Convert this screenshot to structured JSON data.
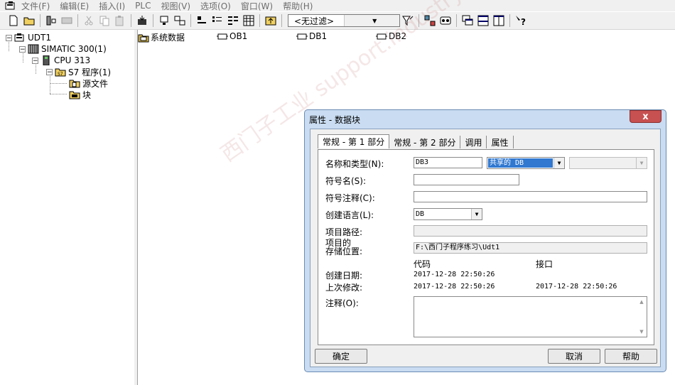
{
  "menubar": {
    "items": [
      "文件(F)",
      "编辑(E)",
      "插入(I)",
      "PLC",
      "视图(V)",
      "选项(O)",
      "窗口(W)",
      "帮助(H)"
    ]
  },
  "toolbar": {
    "filter_value": "<无过滤>"
  },
  "tree": {
    "root": "UDT1",
    "station": "SIMATIC 300(1)",
    "cpu": "CPU 313",
    "program": "S7 程序(1)",
    "sources": "源文件",
    "blocks": "块"
  },
  "content": {
    "items": [
      "系统数据",
      "OB1",
      "DB1",
      "DB2"
    ]
  },
  "watermark": "西门子工业 support.industry.siemens.com 论坛",
  "dialog": {
    "title": "属性 - 数据块",
    "close_label": "x",
    "tabs": [
      "常规 - 第 1 部分",
      "常规 - 第 2 部分",
      "调用",
      "属性"
    ],
    "labels": {
      "name_type": "名称和类型(N):",
      "symbol": "符号名(S):",
      "symbol_comment": "符号注释(C):",
      "language": "创建语言(L):",
      "project_path": "项目路径:",
      "storage_1": "项目的",
      "storage_2": "存储位置:",
      "code_header": "代码",
      "interface_header": "接口",
      "created": "创建日期:",
      "modified": "上次修改:",
      "comment": "注释(O):"
    },
    "values": {
      "name": "DB3",
      "type": "共享的 DB",
      "language": "DB",
      "storage": "F:\\西门子程序练习\\Udt1",
      "created_code": "2017-12-28 22:50:26",
      "modified_code": "2017-12-28 22:50:26",
      "modified_interface": "2017-12-28 22:50:26"
    },
    "buttons": {
      "ok": "确定",
      "cancel": "取消",
      "help": "帮助"
    }
  }
}
